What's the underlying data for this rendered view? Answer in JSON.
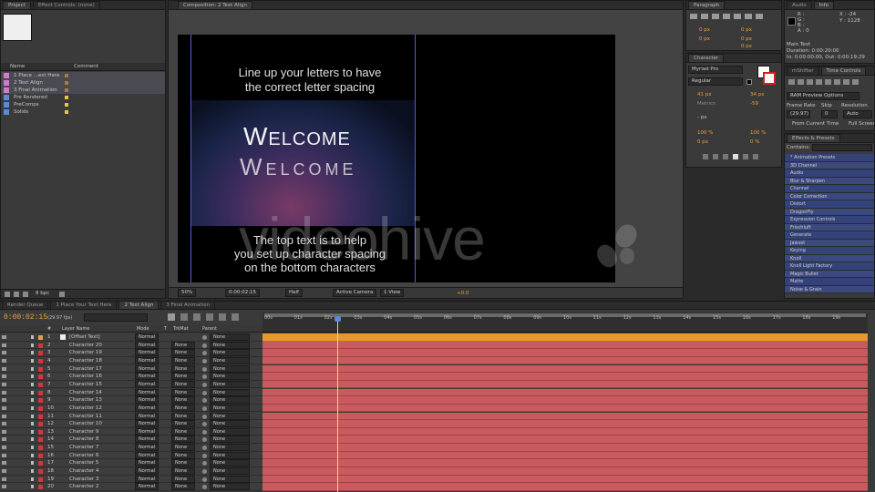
{
  "project_panel": {
    "tabs": [
      "Project",
      "Effect Controls: (none)"
    ],
    "col_name": "Name",
    "col_comment": "Comment",
    "items": [
      "1 Place ...ext Here",
      "2 Text Align",
      "3 Final Animation",
      "Pre Rendered",
      "PreComps",
      "Solids"
    ],
    "bpc": "8 bpc"
  },
  "comp_panel": {
    "tab": "Composition: 2 Text Align",
    "top_text_1": "Line up your letters to have",
    "top_text_2": "the correct letter spacing",
    "welcome_1": "Welcome",
    "welcome_2": "Welcome",
    "bottom_text_1": "The top text is to help",
    "bottom_text_2": "you set up character spacing",
    "bottom_text_3": "on the bottom characters",
    "watermark": "videohive",
    "zoom": "50%",
    "timecode": "0:00:02:15",
    "resolution": "Half",
    "camera": "Active Camera",
    "view": "1 View",
    "exposure": "+0.0"
  },
  "paragraph_panel": {
    "tab": "Paragraph",
    "values": [
      "0 px",
      "0 px",
      "0 px",
      "0 px",
      "0 px"
    ]
  },
  "character_panel": {
    "tab": "Character",
    "font": "Myriad Pro",
    "style": "Regular",
    "size": "41 px",
    "leading": "34 px",
    "kerning": "Metrics",
    "tracking": "-59",
    "stroke": "- px",
    "vscale": "100 %",
    "hscale": "100 %",
    "baseline": "0 px",
    "tsume": "0 %"
  },
  "info_panel": {
    "tabs": [
      "Audio",
      "Info"
    ],
    "channels": [
      "R :",
      "G :",
      "B :",
      "A : 0"
    ],
    "x": "X : -24",
    "y": "Y : 1128",
    "lines": [
      "Main Text",
      "Duration: 0:00:20:00",
      "In: 0:00:00:00, Out: 0:00:19:29"
    ]
  },
  "preview_panel": {
    "tabs": [
      "mShifter",
      "Time Controls"
    ],
    "title": "RAM Preview Options",
    "frame_rate_label": "Frame Rate",
    "skip_label": "Skip",
    "resolution_label": "Resolution",
    "frame_rate": "(29.97)",
    "skip": "0",
    "resolution": "Auto",
    "from_current": "From Current Time",
    "full_screen": "Full Screen"
  },
  "effects_panel": {
    "tab": "Effects & Presets",
    "contains": "Contains:",
    "items": [
      "* Animation Presets",
      "3D Channel",
      "Audio",
      "Blur & Sharpen",
      "Channel",
      "Color Correction",
      "Distort",
      "DragonFly",
      "Expression Controls",
      "Frischluft",
      "Generate",
      "Jawset",
      "Keying",
      "Knoll",
      "Knoll Light Factory",
      "Magic Bullet",
      "Matte",
      "Noise & Grain"
    ]
  },
  "timeline": {
    "tabs": [
      "Render Queue",
      "1 Place Your Text Here",
      "2 Text Align",
      "3 Final Animation"
    ],
    "timecode": "0:00:02:15",
    "fps": "(29.97 fps)",
    "headers": {
      "num": "#",
      "layer_name": "Layer Name",
      "mode": "Mode",
      "t": "T",
      "trkmat": "TrkMat",
      "parent": "Parent"
    },
    "ruler": [
      "00s",
      "01s",
      "02s",
      "03s",
      "04s",
      "05s",
      "06s",
      "07s",
      "08s",
      "09s",
      "10s",
      "11s",
      "12s",
      "13s",
      "14s",
      "15s",
      "16s",
      "17s",
      "18s",
      "19s"
    ],
    "mode_value": "Normal",
    "trkmat_value": "None",
    "parent_value": "None",
    "layers": [
      {
        "num": "1",
        "name": "[Offset Text]"
      },
      {
        "num": "2",
        "name": "Character 20"
      },
      {
        "num": "3",
        "name": "Character 19"
      },
      {
        "num": "4",
        "name": "Character 18"
      },
      {
        "num": "5",
        "name": "Character 17"
      },
      {
        "num": "6",
        "name": "Character 16"
      },
      {
        "num": "7",
        "name": "Character 15"
      },
      {
        "num": "8",
        "name": "Character 14"
      },
      {
        "num": "9",
        "name": "Character 13"
      },
      {
        "num": "10",
        "name": "Character 12"
      },
      {
        "num": "11",
        "name": "Character 11"
      },
      {
        "num": "12",
        "name": "Character 10"
      },
      {
        "num": "13",
        "name": "Character 9"
      },
      {
        "num": "14",
        "name": "Character 8"
      },
      {
        "num": "15",
        "name": "Character 7"
      },
      {
        "num": "16",
        "name": "Character 6"
      },
      {
        "num": "17",
        "name": "Character 5"
      },
      {
        "num": "18",
        "name": "Character 4"
      },
      {
        "num": "19",
        "name": "Character 3"
      },
      {
        "num": "20",
        "name": "Character 2"
      }
    ]
  },
  "colors": {
    "panel": "#3a3a3a",
    "timecode": "#e8a13a",
    "layer_bar": "#c95a5e",
    "offset_bar": "#e69a2e",
    "effects_highlight": "#35467a"
  }
}
